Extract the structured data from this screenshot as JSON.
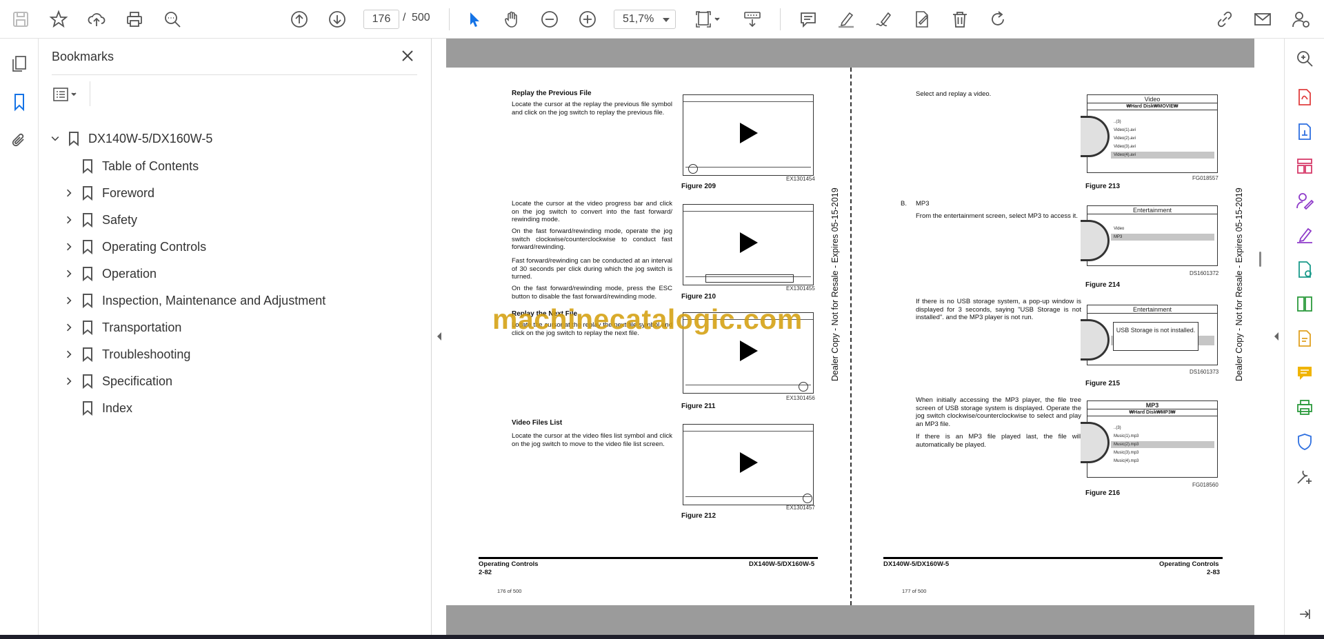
{
  "toolbar": {
    "page_current": "176",
    "page_separator": "/",
    "page_total": "500",
    "zoom": "51,7%"
  },
  "bookmarks": {
    "title": "Bookmarks",
    "root": "DX140W-5/DX160W-5",
    "items": [
      {
        "label": "Table of Contents",
        "expandable": false
      },
      {
        "label": "Foreword",
        "expandable": true
      },
      {
        "label": "Safety",
        "expandable": true
      },
      {
        "label": "Operating Controls",
        "expandable": true
      },
      {
        "label": "Operation",
        "expandable": true
      },
      {
        "label": "Inspection, Maintenance and Adjustment",
        "expandable": true
      },
      {
        "label": "Transportation",
        "expandable": true
      },
      {
        "label": "Troubleshooting",
        "expandable": true
      },
      {
        "label": "Specification",
        "expandable": true
      },
      {
        "label": "Index",
        "expandable": false
      }
    ]
  },
  "left_page": {
    "sec1_head": "Replay the Previous File",
    "sec1_text": "Locate the cursor at the replay the previous file symbol and click on the jog switch to replay the previous file.",
    "fig209": "Figure 209",
    "fig209_code": "EX1301454",
    "sec2_text_a": "Locate the cursor at the video progress bar and click on the jog switch to convert into the fast forward/ rewinding mode.",
    "sec2_text_b": "On the fast forward/rewinding mode, operate the jog switch clockwise/counterclockwise to conduct fast forward/rewinding.",
    "sec2_text_c": "Fast forward/rewinding can be conducted at an interval of 30 seconds per click during which the jog switch is turned.",
    "sec2_text_d": "On the fast forward/rewinding mode, press the ESC button to disable the fast forward/rewinding mode.",
    "fig210": "Figure 210",
    "fig210_code": "EX1301455",
    "sec3_head": "Replay the Next File",
    "sec3_text": "Locate the cursor at the replay the next file symbol and click on the jog switch to replay the next file.",
    "fig211": "Figure 211",
    "fig211_code": "EX1301456",
    "sec4_head": "Video Files List",
    "sec4_text": "Locate the cursor at the video files list symbol and click on the jog switch to move to the video file list screen.",
    "fig212": "Figure 212",
    "fig212_code": "EX1301457",
    "footer_left": "Operating Controls",
    "footer_left_page": "2-82",
    "footer_right": "DX140W-5/DX160W-5",
    "page_of": "176 of 500",
    "vertical": "Dealer Copy - Not for Resale - Expires 05-15-2019"
  },
  "right_page": {
    "sec1_text": "Select and replay a video.",
    "fig213": "Figure 213",
    "fig213_code": "FG018557",
    "fig213_title": "Video",
    "fig213_path": "₩Hard Disk₩MOVIE₩",
    "fig213_rows": [
      "..(3)",
      "Video(1).avi",
      "Video(2).avi",
      "Video(3).avi",
      "Video(4).avi"
    ],
    "secB_letter": "B.",
    "secB_head": "MP3",
    "secB_text": "From the entertainment screen, select MP3 to access it.",
    "fig214": "Figure 214",
    "fig214_code": "DS1601372",
    "fig214_title": "Entertainment",
    "fig214_rows": [
      "Video",
      "MP3"
    ],
    "sec2_text": "If there is no USB storage system, a pop-up window is displayed for 3 seconds, saying \"USB Storage is not installed\". and the MP3 player is not run.",
    "fig215": "Figure 215",
    "fig215_code": "DS1601373",
    "fig215_title": "Entertainment",
    "popup_text": "USB Storage is not installed.",
    "sec3_text_a": "When initially accessing the MP3 player, the file tree screen of USB storage system is displayed. Operate the jog switch clockwise/counterclockwise to select and play an MP3 file.",
    "sec3_text_b": "If there is an MP3 file played last, the file will automatically be played.",
    "fig216": "Figure 216",
    "fig216_code": "FG018560",
    "fig216_title": "MP3",
    "fig216_path": "₩Hard Disk₩MP3₩",
    "fig216_rows": [
      "..(3)",
      "Music(1).mp3",
      "Music(2).mp3",
      "Music(3).mp3",
      "Music(4).mp3"
    ],
    "footer_left": "DX140W-5/DX160W-5",
    "footer_right": "Operating Controls",
    "footer_right_page": "2-83",
    "page_of": "177 of 500",
    "vertical": "Dealer Copy - Not for Resale - Expires 05-15-2019"
  },
  "watermark": "machinecatalogic.com",
  "colors": {
    "accent_blue": "#1473e6",
    "tool_purple": "#8e3ac9",
    "watermark": "#d4a010"
  }
}
